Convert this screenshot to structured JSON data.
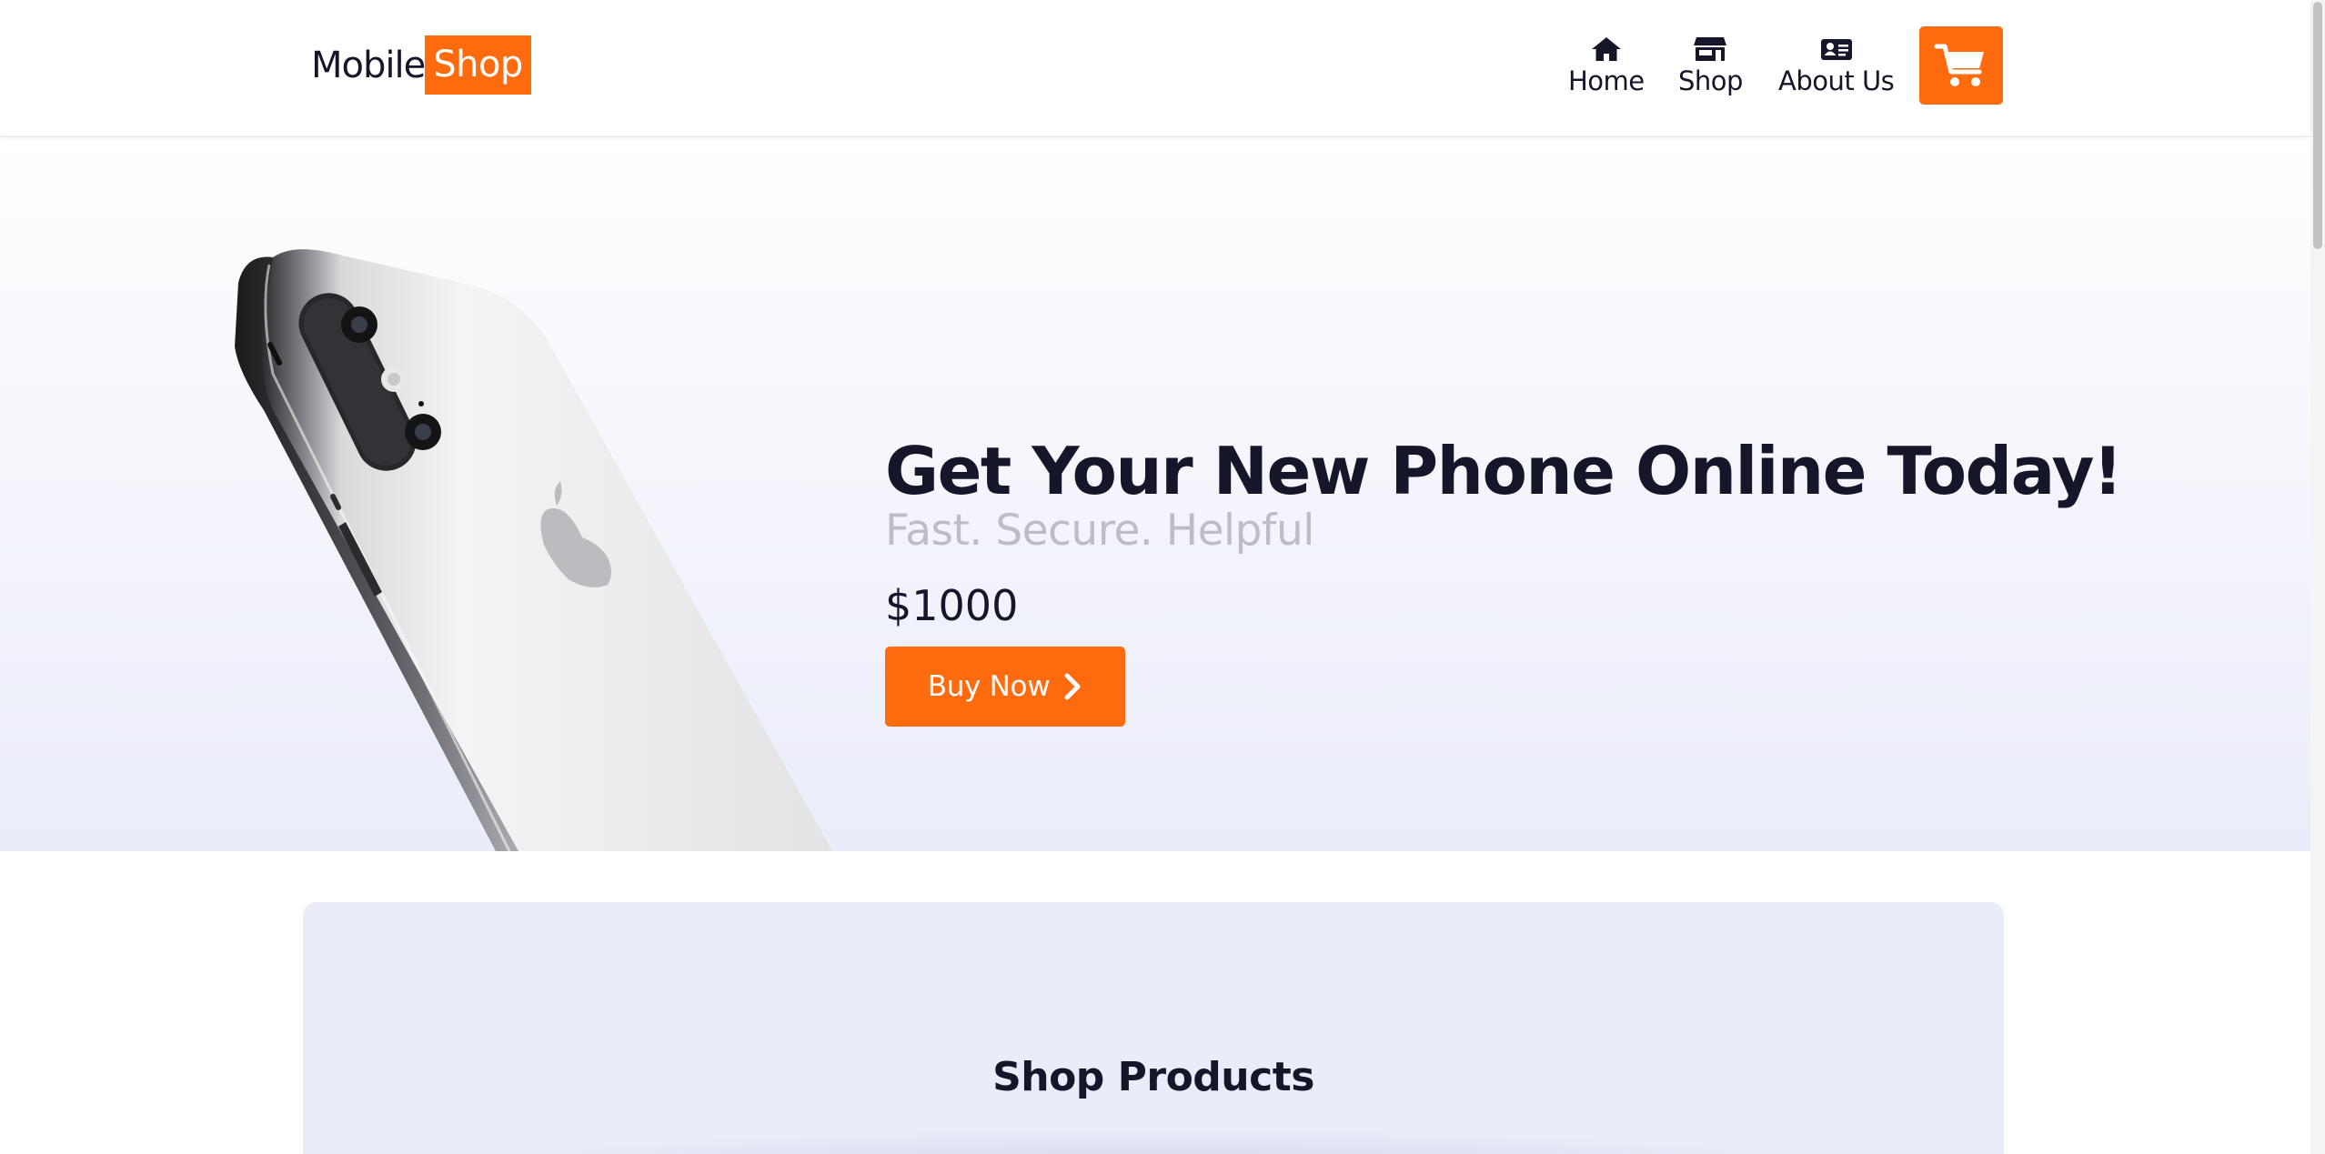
{
  "header": {
    "logo": {
      "part1": "Mobile",
      "part2": "Shop"
    },
    "nav": [
      {
        "label": "Home",
        "icon": "home-icon"
      },
      {
        "label": "Shop",
        "icon": "store-icon"
      },
      {
        "label": "About Us",
        "icon": "id-card-icon"
      }
    ],
    "cart_icon": "shopping-cart-icon"
  },
  "hero": {
    "title": "Get Your New Phone Online Today!",
    "subtitle": "Fast. Secure. Helpful",
    "price": "$1000",
    "button_label": "Buy Now",
    "button_icon": "chevron-right-icon"
  },
  "shop": {
    "title": "Shop Products"
  },
  "colors": {
    "accent": "#fe6b0f",
    "text_dark": "#16162b",
    "subtitle_gray": "#bdbdc5",
    "section_bg": "#eaecf9"
  }
}
